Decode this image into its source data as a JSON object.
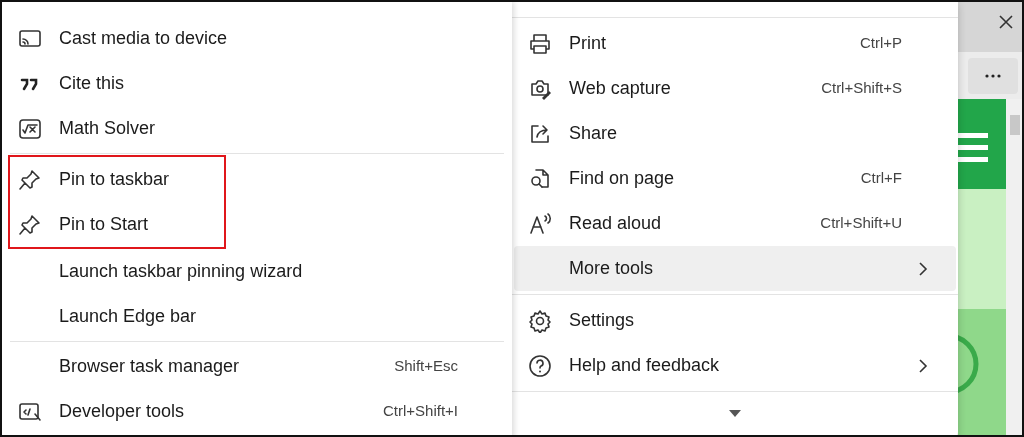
{
  "submenu": {
    "groups": [
      {
        "items": [
          {
            "label": "Cast media to device",
            "kind": "cast",
            "outlined": false
          },
          {
            "label": "Cite this",
            "kind": "quote",
            "outlined": false
          },
          {
            "label": "Math Solver",
            "kind": "math",
            "outlined": false
          }
        ]
      },
      {
        "items": [
          {
            "label": "Pin to taskbar",
            "kind": "pin",
            "outlined": true
          },
          {
            "label": "Pin to Start",
            "kind": "pin",
            "outlined": true
          },
          {
            "label": "Launch taskbar pinning wizard",
            "outlined": false
          },
          {
            "label": "Launch Edge bar",
            "outlined": false
          }
        ]
      },
      {
        "items": [
          {
            "label": "Browser task manager",
            "shortcut": "Shift+Esc",
            "outlined": false
          },
          {
            "label": "Developer tools",
            "kind": "devtools",
            "shortcut": "Ctrl+Shift+I",
            "outlined": false
          }
        ]
      }
    ]
  },
  "menu": {
    "groups": [
      {
        "items": [
          {
            "label": "Print",
            "kind": "print",
            "shortcut": "Ctrl+P",
            "selected": false,
            "has_submenu": false
          },
          {
            "label": "Web capture",
            "kind": "capture",
            "shortcut": "Ctrl+Shift+S",
            "selected": false,
            "has_submenu": false
          },
          {
            "label": "Share",
            "kind": "share",
            "selected": false,
            "has_submenu": false
          },
          {
            "label": "Find on page",
            "kind": "find",
            "shortcut": "Ctrl+F",
            "selected": false,
            "has_submenu": false
          },
          {
            "label": "Read aloud",
            "kind": "read",
            "shortcut": "Ctrl+Shift+U",
            "selected": false,
            "has_submenu": false
          },
          {
            "label": "More tools",
            "selected": true,
            "has_submenu": true
          }
        ]
      },
      {
        "items": [
          {
            "label": "Settings",
            "kind": "gear",
            "selected": false,
            "has_submenu": false
          },
          {
            "label": "Help and feedback",
            "kind": "help",
            "selected": false,
            "has_submenu": true
          }
        ]
      }
    ]
  }
}
